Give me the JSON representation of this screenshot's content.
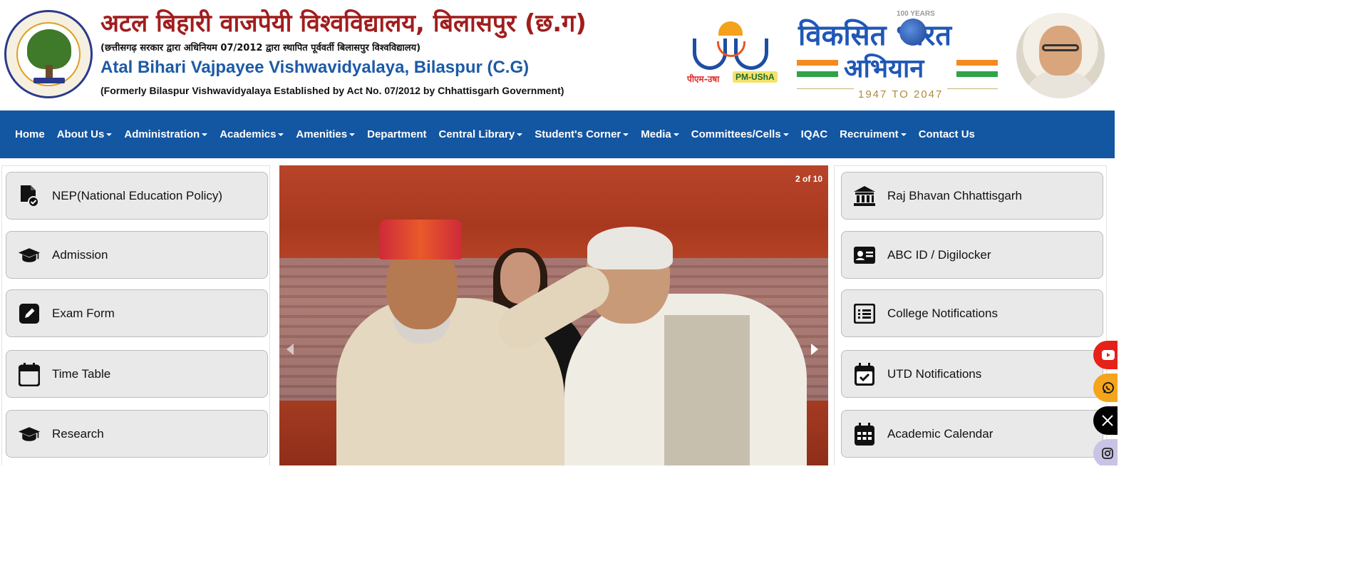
{
  "header": {
    "title_hindi": "अटल बिहारी वाजपेयी विश्वविद्यालय, बिलासपुर (छ.ग)",
    "subtitle_hindi": "(छत्तीसगढ़ सरकार द्वारा अधिनियम 07/2012 द्वारा स्थापित पूर्ववर्ती बिलासपुर विश्वविद्यालय)",
    "title_english": "Atal Bihari Vajpayee Vishwavidyalaya, Bilaspur (C.G)",
    "subtitle_english": "(Formerly Bilaspur Vishwavidyalaya Established by Act No. 07/2012 by Chhattisgarh Government)",
    "pmusha_hindi": "पीएम-उषा",
    "pmusha_english": "PM-UShA",
    "viksit_line1": "विकसित भारत",
    "viksit_line2": "अभियान",
    "viksit_years_badge": "100 YEARS",
    "viksit_years": "1947 TO 2047"
  },
  "nav": [
    {
      "label": "Home",
      "dropdown": false
    },
    {
      "label": "About Us",
      "dropdown": true
    },
    {
      "label": "Administration",
      "dropdown": true
    },
    {
      "label": "Academics",
      "dropdown": true
    },
    {
      "label": "Amenities",
      "dropdown": true
    },
    {
      "label": "Department",
      "dropdown": false
    },
    {
      "label": "Central Library",
      "dropdown": true
    },
    {
      "label": "Student's Corner",
      "dropdown": true
    },
    {
      "label": "Media",
      "dropdown": true
    },
    {
      "label": "Committees/Cells",
      "dropdown": true
    },
    {
      "label": "IQAC",
      "dropdown": false
    },
    {
      "label": "Recruiment",
      "dropdown": true
    },
    {
      "label": "Contact Us",
      "dropdown": false
    }
  ],
  "left_links": [
    {
      "label": "NEP(National Education Policy)",
      "icon": "document-check-icon"
    },
    {
      "label": "Admission",
      "icon": "graduation-cap-icon"
    },
    {
      "label": "Exam Form",
      "icon": "pencil-square-icon"
    },
    {
      "label": "Time Table",
      "icon": "calendar-icon"
    },
    {
      "label": "Research",
      "icon": "graduation-cap-icon"
    }
  ],
  "right_links": [
    {
      "label": "Raj Bhavan Chhattisgarh",
      "icon": "building-columns-icon"
    },
    {
      "label": "ABC ID / Digilocker",
      "icon": "id-card-icon"
    },
    {
      "label": "College Notifications",
      "icon": "list-icon"
    },
    {
      "label": "UTD Notifications",
      "icon": "calendar-check-icon"
    },
    {
      "label": "Academic Calendar",
      "icon": "calendar-days-icon"
    }
  ],
  "slider": {
    "counter": "2 of 10"
  },
  "social": [
    {
      "name": "youtube-icon",
      "color": "#e62117"
    },
    {
      "name": "whatsapp-icon",
      "color": "#f4a51c"
    },
    {
      "name": "x-twitter-icon",
      "color": "#000000"
    },
    {
      "name": "instagram-icon",
      "color": "#c9c3e6"
    }
  ],
  "colors": {
    "nav_bg": "#1356a2",
    "title_red": "#a11d1d",
    "title_blue": "#1d5aa6",
    "button_bg": "#e9e9e9"
  }
}
